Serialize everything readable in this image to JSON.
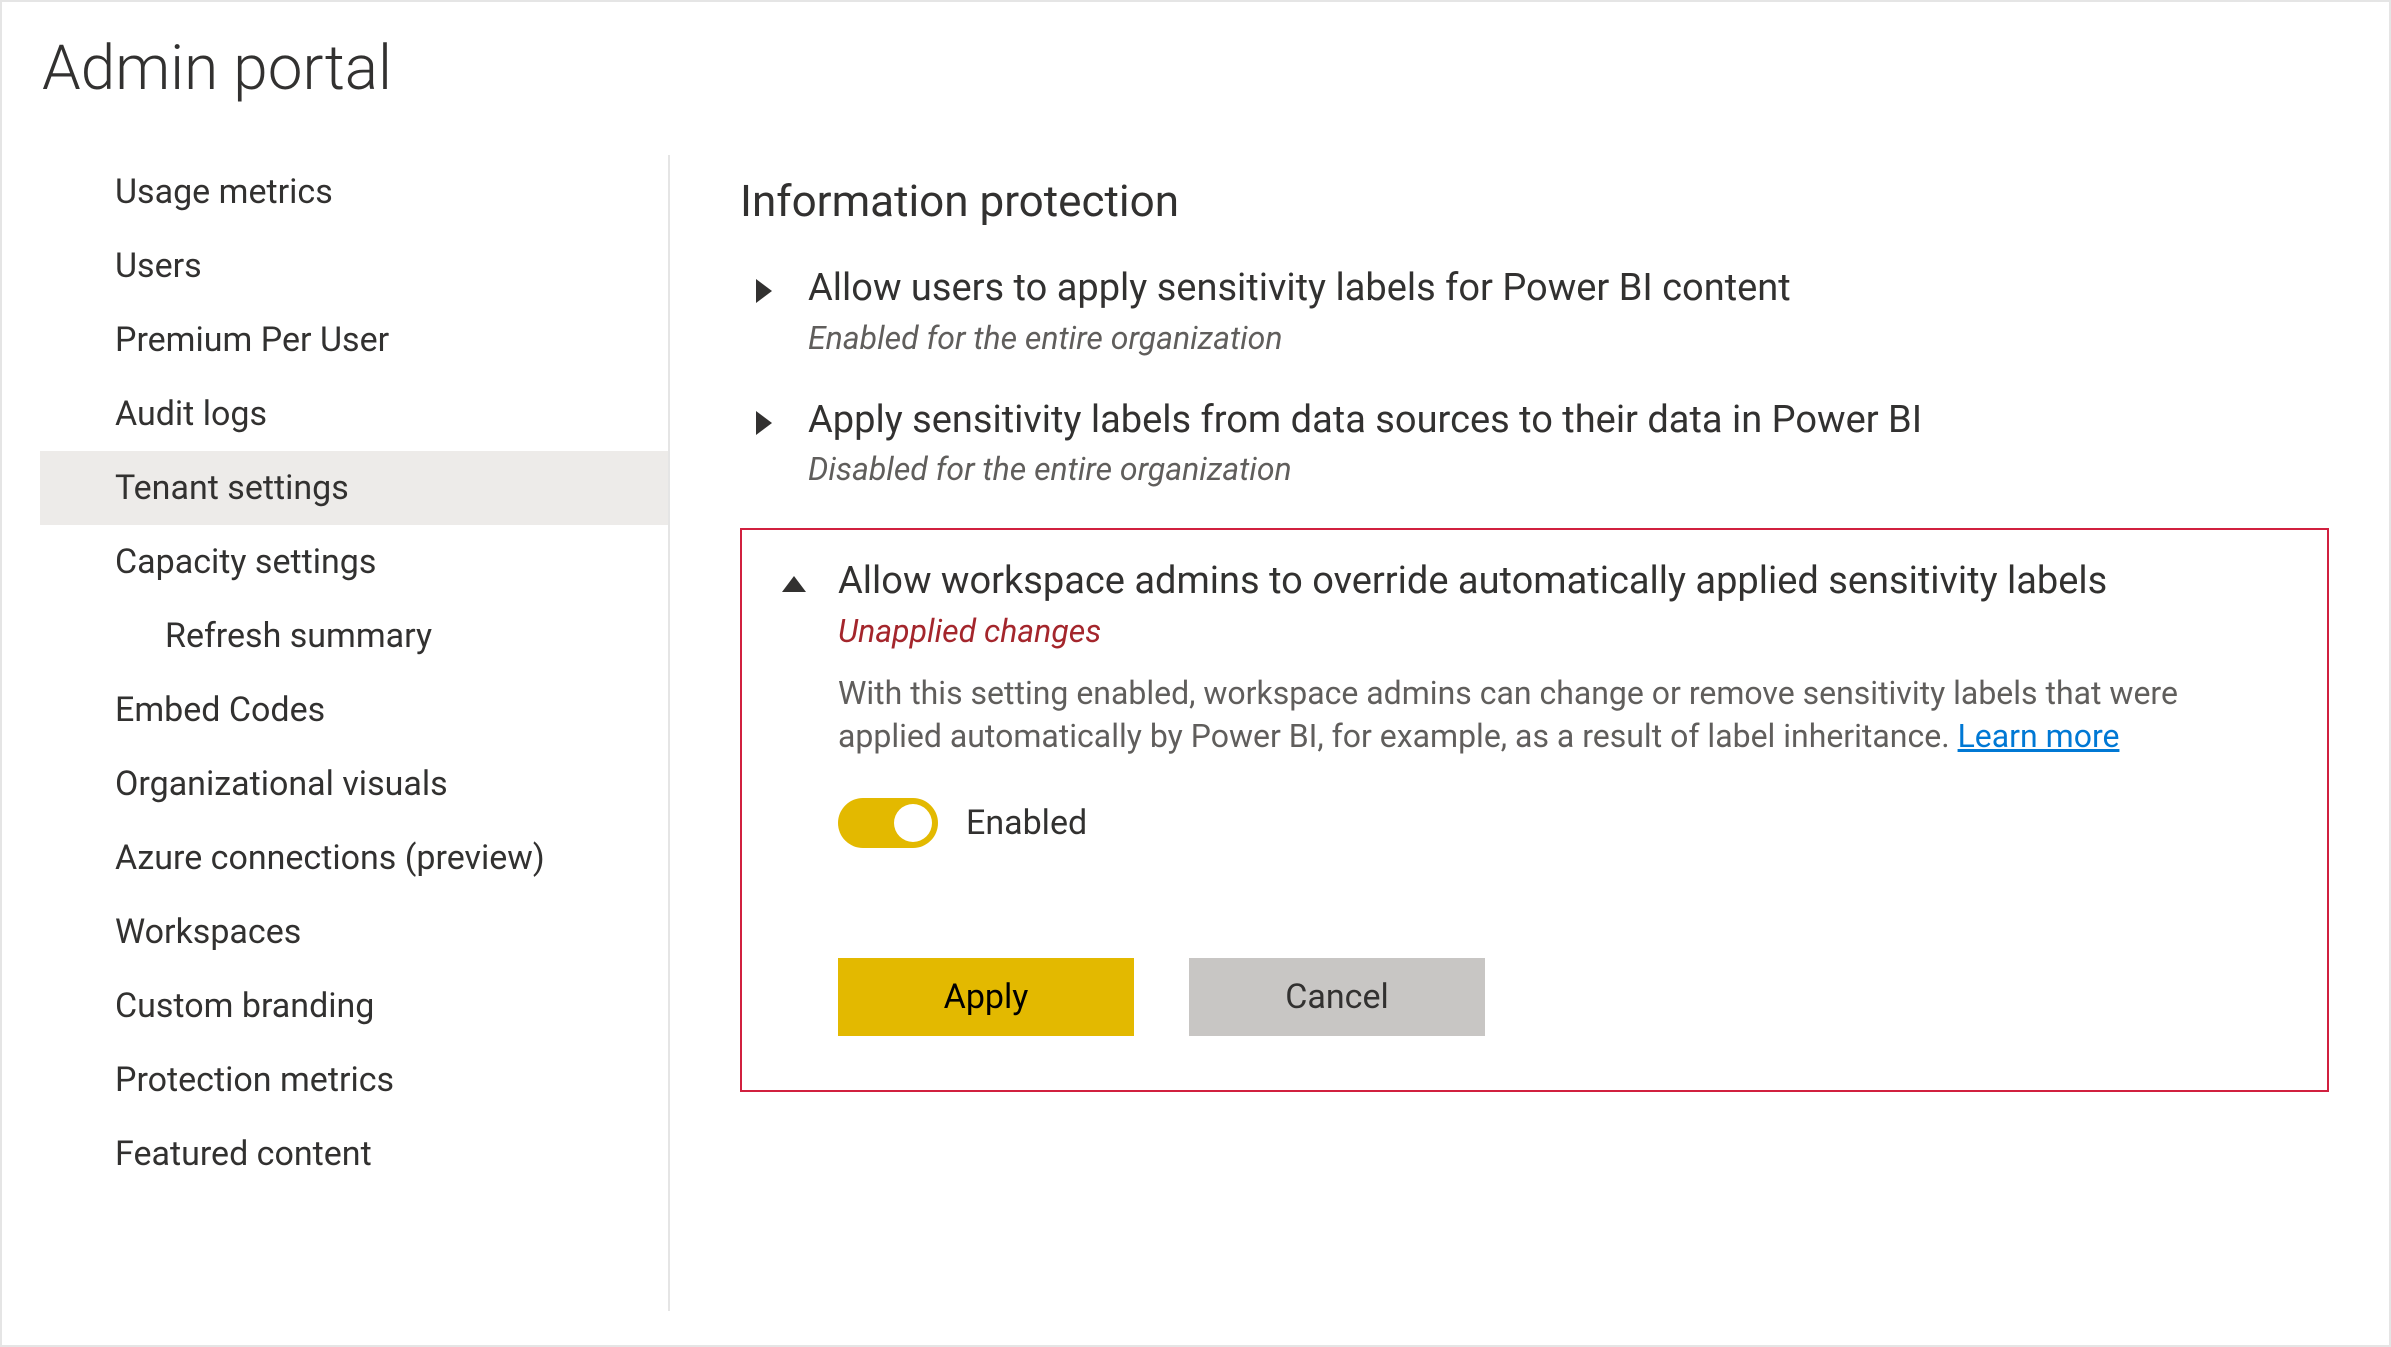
{
  "page_title": "Admin portal",
  "sidebar": {
    "items": [
      {
        "label": "Usage metrics",
        "selected": false,
        "indent": false
      },
      {
        "label": "Users",
        "selected": false,
        "indent": false
      },
      {
        "label": "Premium Per User",
        "selected": false,
        "indent": false
      },
      {
        "label": "Audit logs",
        "selected": false,
        "indent": false
      },
      {
        "label": "Tenant settings",
        "selected": true,
        "indent": false
      },
      {
        "label": "Capacity settings",
        "selected": false,
        "indent": false
      },
      {
        "label": "Refresh summary",
        "selected": false,
        "indent": true
      },
      {
        "label": "Embed Codes",
        "selected": false,
        "indent": false
      },
      {
        "label": "Organizational visuals",
        "selected": false,
        "indent": false
      },
      {
        "label": "Azure connections (preview)",
        "selected": false,
        "indent": false
      },
      {
        "label": "Workspaces",
        "selected": false,
        "indent": false
      },
      {
        "label": "Custom branding",
        "selected": false,
        "indent": false
      },
      {
        "label": "Protection metrics",
        "selected": false,
        "indent": false
      },
      {
        "label": "Featured content",
        "selected": false,
        "indent": false
      }
    ]
  },
  "main": {
    "section_heading": "Information protection",
    "settings": [
      {
        "expanded": false,
        "title": "Allow users to apply sensitivity labels for Power BI content",
        "status": "Enabled for the entire organization"
      },
      {
        "expanded": false,
        "title": "Apply sensitivity labels from data sources to their data in Power BI",
        "status": "Disabled for the entire organization"
      }
    ],
    "expanded_setting": {
      "title": "Allow workspace admins to override automatically applied sensitivity labels",
      "unapplied_notice": "Unapplied changes",
      "description": "With this setting enabled, workspace admins can change or remove sensitivity labels that were applied automatically by Power BI, for example, as a result of label inheritance.",
      "learn_more_label": "Learn more",
      "toggle_on": true,
      "toggle_label": "Enabled",
      "apply_label": "Apply",
      "cancel_label": "Cancel"
    }
  },
  "colors": {
    "accent_yellow": "#e3b900",
    "highlight_border": "#d1203f",
    "link": "#0078d4"
  }
}
